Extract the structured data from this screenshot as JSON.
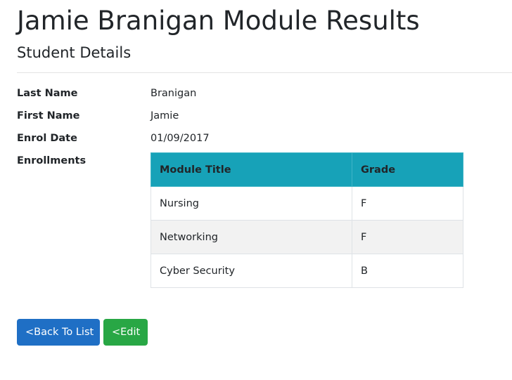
{
  "page": {
    "title": "Jamie Branigan Module Results",
    "section_title": "Student Details"
  },
  "details": {
    "last_name_label": "Last Name",
    "last_name_value": "Branigan",
    "first_name_label": "First Name",
    "first_name_value": "Jamie",
    "enrol_date_label": "Enrol Date",
    "enrol_date_value": "01/09/2017",
    "enrollments_label": "Enrollments"
  },
  "enrollments": {
    "headers": [
      "Module Title",
      "Grade"
    ],
    "rows": [
      {
        "module": "Nursing",
        "grade": "F"
      },
      {
        "module": "Networking",
        "grade": "F"
      },
      {
        "module": "Cyber Security",
        "grade": "B"
      }
    ]
  },
  "actions": {
    "back_label": "<Back To List",
    "edit_label": "<Edit"
  },
  "colors": {
    "table_header_bg": "#17a2b8",
    "back_button_bg": "#1f6fc5",
    "edit_button_bg": "#28a745",
    "striped_row_bg": "#f2f2f2"
  }
}
